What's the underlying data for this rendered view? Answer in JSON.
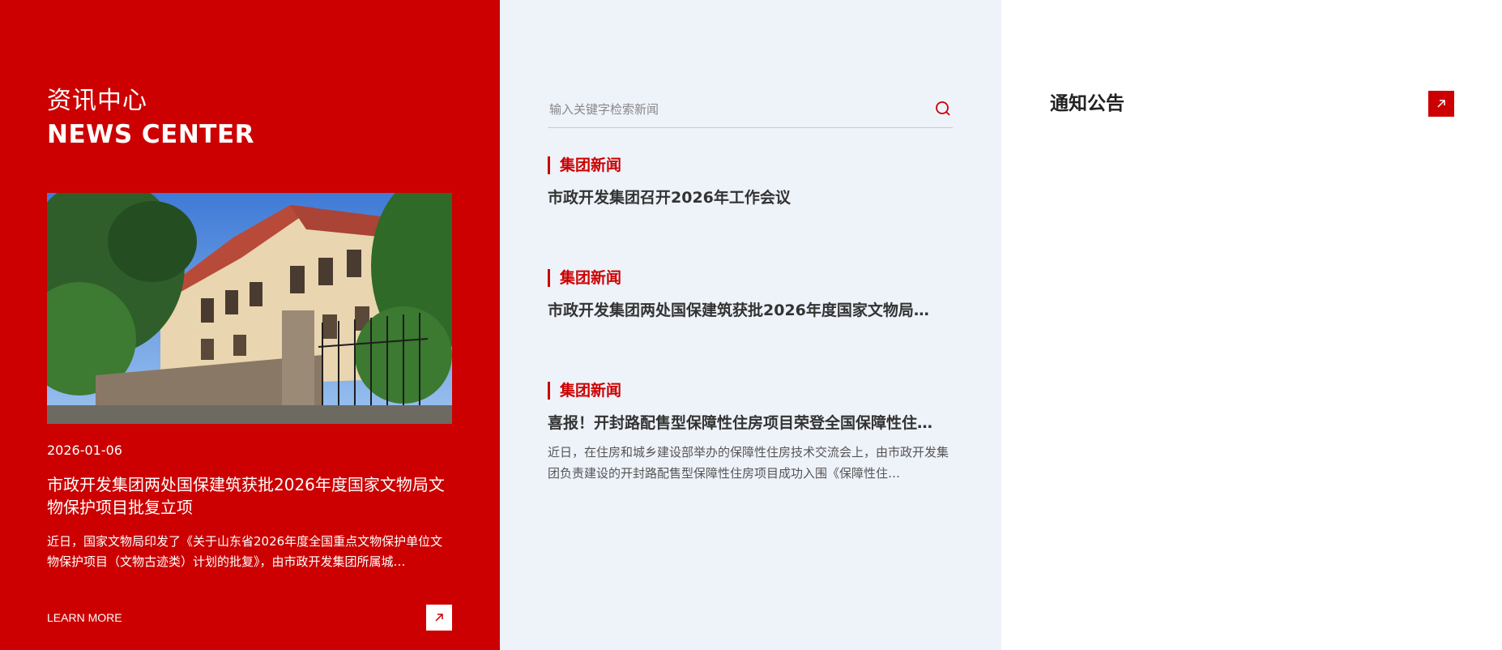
{
  "left": {
    "title_cn": "资讯中心",
    "title_en": "NEWS CENTER",
    "featured": {
      "date": "2026-01-06",
      "headline": "市政开发集团两处国保建筑获批2026年度国家文物局文物保护项目批复立项",
      "summary": "近日，国家文物局印发了《关于山东省2026年度全国重点文物保护单位文物保护项目（文物古迹类）计划的批复》，由市政开发集团所属城…"
    },
    "more_label": "LEARN MORE",
    "more_icon": "arrow-up-right-icon"
  },
  "search": {
    "placeholder": "输入关键字检索新闻",
    "icon": "search-icon"
  },
  "news": [
    {
      "tag": "集团新闻",
      "title": "市政开发集团召开2026年工作会议"
    },
    {
      "tag": "集团新闻",
      "title": "市政开发集团两处国保建筑获批2026年度国家文物局…"
    },
    {
      "tag": "集团新闻",
      "title": "喜报！开封路配售型保障性住房项目荣登全国保障性住…",
      "desc": "近日，在住房和城乡建设部举办的保障性住房技术交流会上，由市政开发集团负责建设的开封路配售型保障性住房项目成功入围《保障性住…"
    }
  ],
  "notice": {
    "title": "通知公告",
    "icon": "arrow-up-right-icon"
  },
  "colors": {
    "brand_red": "#cc0000",
    "middle_bg": "#eef2f9"
  }
}
